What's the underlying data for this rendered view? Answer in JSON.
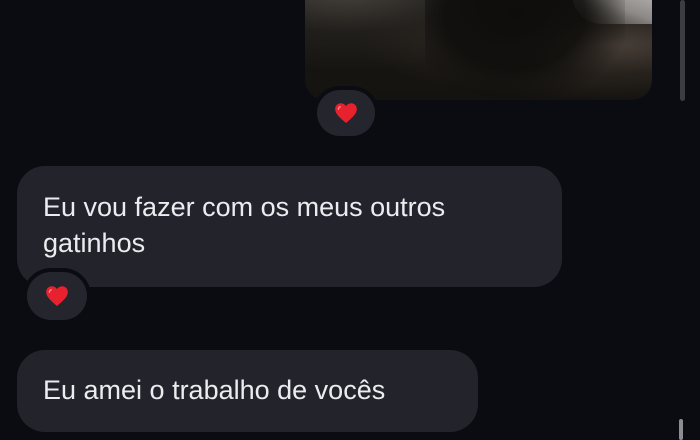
{
  "messages": [
    {
      "kind": "image",
      "sender": "outgoing",
      "reaction": "heart-icon"
    },
    {
      "kind": "text",
      "sender": "incoming",
      "text": "Eu vou fazer com os meus outros gatinhos",
      "reaction": "heart-icon"
    },
    {
      "kind": "text",
      "sender": "incoming",
      "text": "Eu amei o trabalho de vocês"
    }
  ],
  "colors": {
    "background": "#0b0c12",
    "bubble": "#23242b",
    "bubble_text": "#ececf0",
    "reaction_pill": "#25262d",
    "heart": "#e8212f"
  }
}
